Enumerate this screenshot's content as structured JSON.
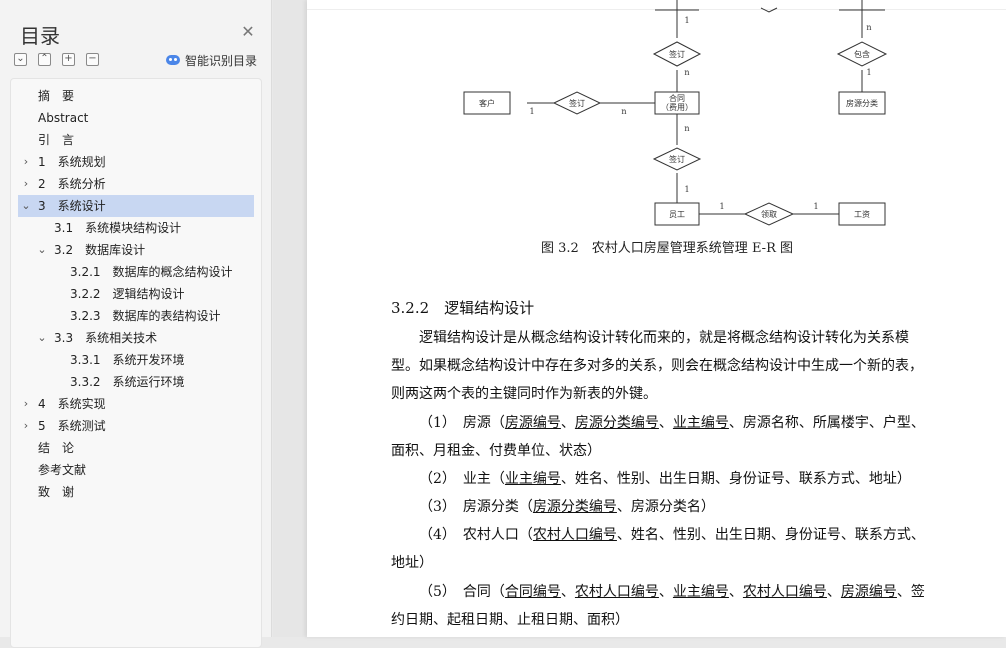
{
  "sidebar": {
    "title": "目录",
    "smart_label": "智能识别目录",
    "toc": [
      {
        "label": "摘　要",
        "level": 0
      },
      {
        "label": "Abstract",
        "level": 0
      },
      {
        "label": "引　言",
        "level": 0
      },
      {
        "label": "1　系统规划",
        "level": 0,
        "chev": "right"
      },
      {
        "label": "2　系统分析",
        "level": 0,
        "chev": "right"
      },
      {
        "label": "3　系统设计",
        "level": 0,
        "chev": "down",
        "active": true
      },
      {
        "label": "3.1　系统模块结构设计",
        "level": 1
      },
      {
        "label": "3.2　数据库设计",
        "level": 1,
        "chev": "down"
      },
      {
        "label": "3.2.1　数据库的概念结构设计",
        "level": 2
      },
      {
        "label": "3.2.2　逻辑结构设计",
        "level": 2
      },
      {
        "label": "3.2.3　数据库的表结构设计",
        "level": 2
      },
      {
        "label": "3.3　系统相关技术",
        "level": 1,
        "chev": "down"
      },
      {
        "label": "3.3.1　系统开发环境",
        "level": 2
      },
      {
        "label": "3.3.2　系统运行环境",
        "level": 2
      },
      {
        "label": "4　系统实现",
        "level": 0,
        "chev": "right"
      },
      {
        "label": "5　系统测试",
        "level": 0,
        "chev": "right"
      },
      {
        "label": "结　论",
        "level": 0
      },
      {
        "label": "参考文献",
        "level": 0
      },
      {
        "label": "致　谢",
        "level": 0
      }
    ]
  },
  "diagram": {
    "entities": {
      "customer": "客户",
      "contract_line1": "合同",
      "contract_line2": "（费用）",
      "house_category": "房源分类",
      "employee": "员工",
      "salary": "工资"
    },
    "relations": {
      "sign_top": "签订",
      "contain": "包含",
      "sign_left": "签订",
      "sign_bottom": "签订",
      "receive": "领取"
    },
    "cardinalities": {
      "c1": "1",
      "c2": "n",
      "c3": "n",
      "c4": "1",
      "c5": "1",
      "c6": "n",
      "c7": "n",
      "c8": "1",
      "c9": "1",
      "c10": "1"
    }
  },
  "document": {
    "figure_caption": "图 3.2　农村人口房屋管理系统管理 E-R 图",
    "section_heading": "3.2.2　逻辑结构设计",
    "intro_lines": [
      "逻辑结构设计是从概念结构设计转化而来的，就是将概念结构设计转化为关系模",
      "型。如果概念结构设计中存在多对多的关系，则会在概念结构设计中生成一个新的表，",
      "则两这两个表的主键同时作为新表的外键。"
    ],
    "items": {
      "i1_prefix": "（1）　房源（",
      "i1_k1": "房源编号",
      "i1_k2": "房源分类编号",
      "i1_k3": "业主编号",
      "i1_rest": "、房源名称、所属楼宇、户型、",
      "i1_line2": "面积、月租金、付费单位、状态）",
      "i2_prefix": "（2）　业主（",
      "i2_k1": "业主编号",
      "i2_rest": "、姓名、性别、出生日期、身份证号、联系方式、地址）",
      "i3_prefix": "（3）　房源分类（",
      "i3_k1": "房源分类编号",
      "i3_rest": "、房源分类名）",
      "i4_prefix": "（4）　农村人口（",
      "i4_k1": "农村人口编号",
      "i4_rest": "、姓名、性别、出生日期、身份证号、联系方式、",
      "i4_line2": "地址）",
      "i5_prefix": "（5）　合同（",
      "i5_k1": "合同编号",
      "i5_k2": "农村人口编号",
      "i5_k3": "业主编号",
      "i5_k4": "农村人口编号",
      "i5_k5": "房源编号",
      "i5_rest": "、签",
      "i5_line2": "约日期、起租日期、止租日期、面积）"
    },
    "sep": "、"
  }
}
